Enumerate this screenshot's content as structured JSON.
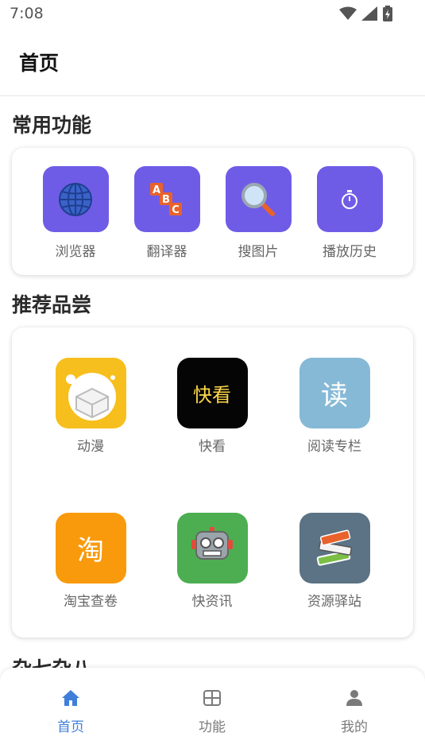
{
  "status": {
    "time": "7:08",
    "icons": [
      "wifi-icon",
      "signal-icon",
      "battery-icon"
    ]
  },
  "header": {
    "title": "首页"
  },
  "sections": {
    "common": {
      "title": "常用功能",
      "items": [
        {
          "label": "浏览器",
          "icon": "globe-icon"
        },
        {
          "label": "翻译器",
          "icon": "abc-blocks-icon"
        },
        {
          "label": "搜图片",
          "icon": "magnifier-icon"
        },
        {
          "label": "播放历史",
          "icon": "stopwatch-icon"
        }
      ]
    },
    "recommend": {
      "title": "推荐品尝",
      "items": [
        {
          "label": "动漫",
          "icon": "anime-box-icon",
          "tile_color": "#f7bf1d"
        },
        {
          "label": "快看",
          "icon_text": "快看",
          "tile_color": "#050505"
        },
        {
          "label": "阅读专栏",
          "icon_text": "读",
          "tile_color": "#86b9d6"
        },
        {
          "label": "淘宝查卷",
          "icon_text": "淘",
          "tile_color": "#f99a0c"
        },
        {
          "label": "快资讯",
          "icon": "robot-icon",
          "tile_color": "#4cae50"
        },
        {
          "label": "资源驿站",
          "icon": "books-icon",
          "tile_color": "#5b7384"
        }
      ]
    },
    "misc": {
      "title": "杂七杂八"
    }
  },
  "bottom_nav": {
    "active_color": "#3f7fd9",
    "inactive_color": "#7a7a7a",
    "items": [
      {
        "label": "首页",
        "icon": "home-icon",
        "active": true
      },
      {
        "label": "功能",
        "icon": "grid-icon",
        "active": false
      },
      {
        "label": "我的",
        "icon": "person-icon",
        "active": false
      }
    ]
  }
}
